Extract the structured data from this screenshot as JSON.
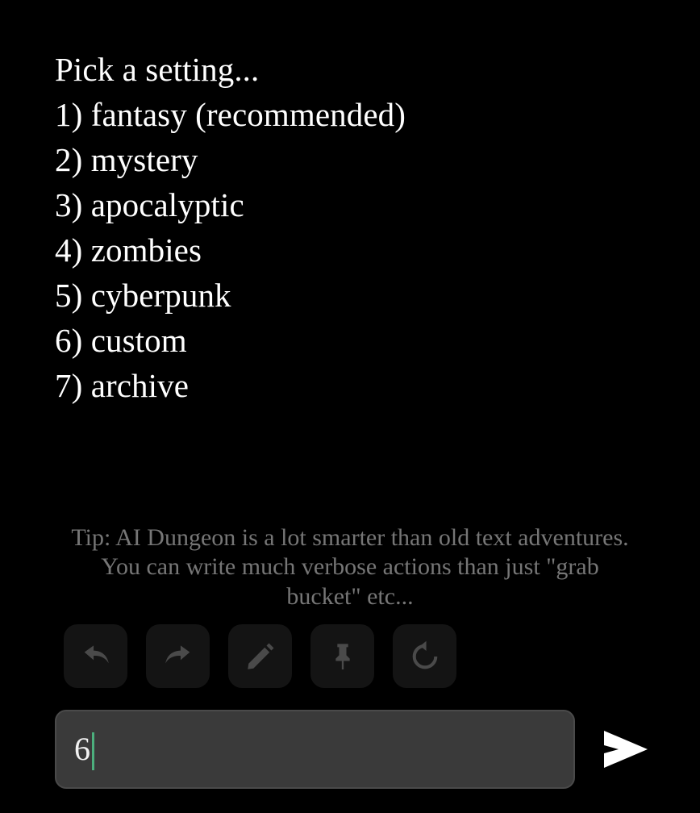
{
  "app": {
    "name": "AI Dungeon",
    "background_color": "#000000",
    "text_color": "#ffffff"
  },
  "story": {
    "lines": [
      "Pick a setting...",
      "1) fantasy (recommended)",
      "2) mystery",
      "3) apocalyptic",
      "4) zombies",
      "5) cyberpunk",
      "6) custom",
      "7) archive"
    ]
  },
  "tip": {
    "text": "Tip: AI Dungeon is a lot smarter than old text adventures. You can write much verbose actions than just \"grab bucket\" etc...",
    "color": "#767676"
  },
  "toolbar": {
    "buttons": [
      {
        "name": "undo-button",
        "icon": "undo-icon",
        "label": "Undo"
      },
      {
        "name": "redo-button",
        "icon": "redo-icon",
        "label": "Redo"
      },
      {
        "name": "edit-button",
        "icon": "pencil-icon",
        "label": "Edit"
      },
      {
        "name": "pin-button",
        "icon": "pin-icon",
        "label": "Pin"
      },
      {
        "name": "retry-button",
        "icon": "retry-icon",
        "label": "Retry"
      }
    ],
    "button_background": "#141414",
    "icon_color": "#4a4a4a"
  },
  "input": {
    "value": "6",
    "placeholder": "",
    "caret_color": "#4caf7d",
    "background_color": "#3a3a3a",
    "border_color": "#4a4a4a"
  },
  "send": {
    "label": "Send",
    "icon": "send-icon",
    "color": "#ffffff"
  }
}
